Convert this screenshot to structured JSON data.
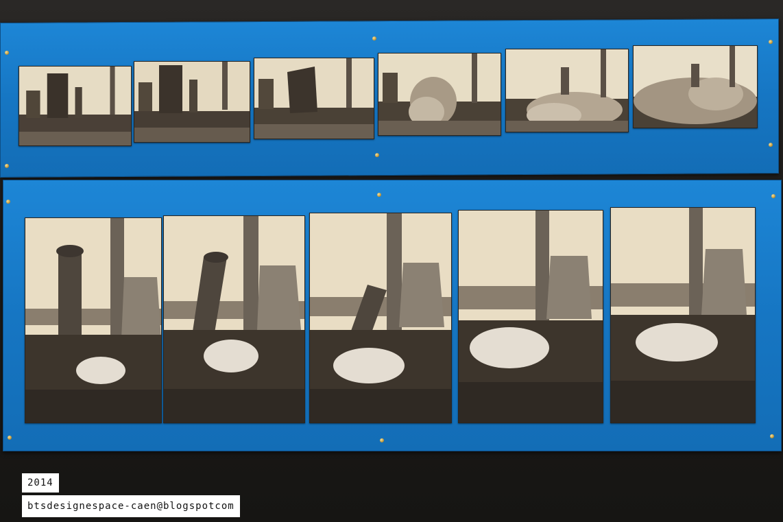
{
  "caption": {
    "year": "2014",
    "blog": "btsdesignespace-caen@blogspotcom"
  },
  "colors": {
    "panel_blue": "#1676c3",
    "wall": "#1c1a18",
    "sepia_sky": "#e6dcc4",
    "sepia_ground": "#3d352c"
  },
  "top_strip": {
    "frames": [
      {
        "stage": "standing"
      },
      {
        "stage": "standing"
      },
      {
        "stage": "tilting"
      },
      {
        "stage": "dust"
      },
      {
        "stage": "collapsed"
      },
      {
        "stage": "cloud"
      }
    ]
  },
  "bottom_strip": {
    "frames": [
      {
        "stage": "upright"
      },
      {
        "stage": "leaning"
      },
      {
        "stage": "falling"
      },
      {
        "stage": "gone"
      },
      {
        "stage": "gone"
      }
    ]
  }
}
